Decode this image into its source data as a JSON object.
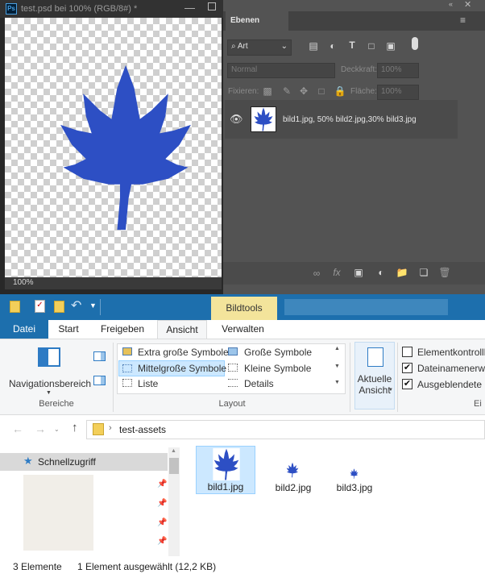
{
  "photoshop": {
    "doc_title": "test.psd bei 100% (RGB/8#) *",
    "app_badge": "Ps",
    "zoom": "100%",
    "panel_title": "Ebenen",
    "filter_kind": "Art",
    "blend_mode": "Normal",
    "opacity_label": "Deckkraft:",
    "opacity_value": "100%",
    "lock_label": "Fixieren:",
    "fill_label": "Fläche:",
    "fill_value": "100%",
    "layer_name": "bild1.jpg, 50% bild2.jpg,30% bild3.jpg",
    "leaf_color": "#2d4fc4"
  },
  "explorer": {
    "contextual_tab": "Bildtools",
    "tabs": [
      "Datei",
      "Start",
      "Freigeben",
      "Ansicht",
      "Verwalten"
    ],
    "ribbon": {
      "nav_pane_label": "Navigationsbereich",
      "panes_group": "Bereiche",
      "layout_items": [
        "Extra große Symbole",
        "Große Symbole",
        "Mittelgroße Symbole",
        "Kleine Symbole",
        "Liste",
        "Details"
      ],
      "layout_group": "Layout",
      "current_view_label": "Aktuelle Ansicht",
      "checkboxes": [
        {
          "label": "Elementkontrollk",
          "checked": false
        },
        {
          "label": "Dateinamenerwe",
          "checked": true
        },
        {
          "label": "Ausgeblendete E",
          "checked": true
        }
      ],
      "overflow_label": "Ei"
    },
    "address_folder": "test-assets",
    "nav_quick_access": "Schnellzugriff",
    "files": [
      "bild1.jpg",
      "bild2.jpg",
      "bild3.jpg"
    ],
    "status_count": "3 Elemente",
    "status_selection": "1 Element ausgewählt (12,2 KB)",
    "accent": "#1d6fad",
    "tools_accent": "#f3e49b"
  }
}
